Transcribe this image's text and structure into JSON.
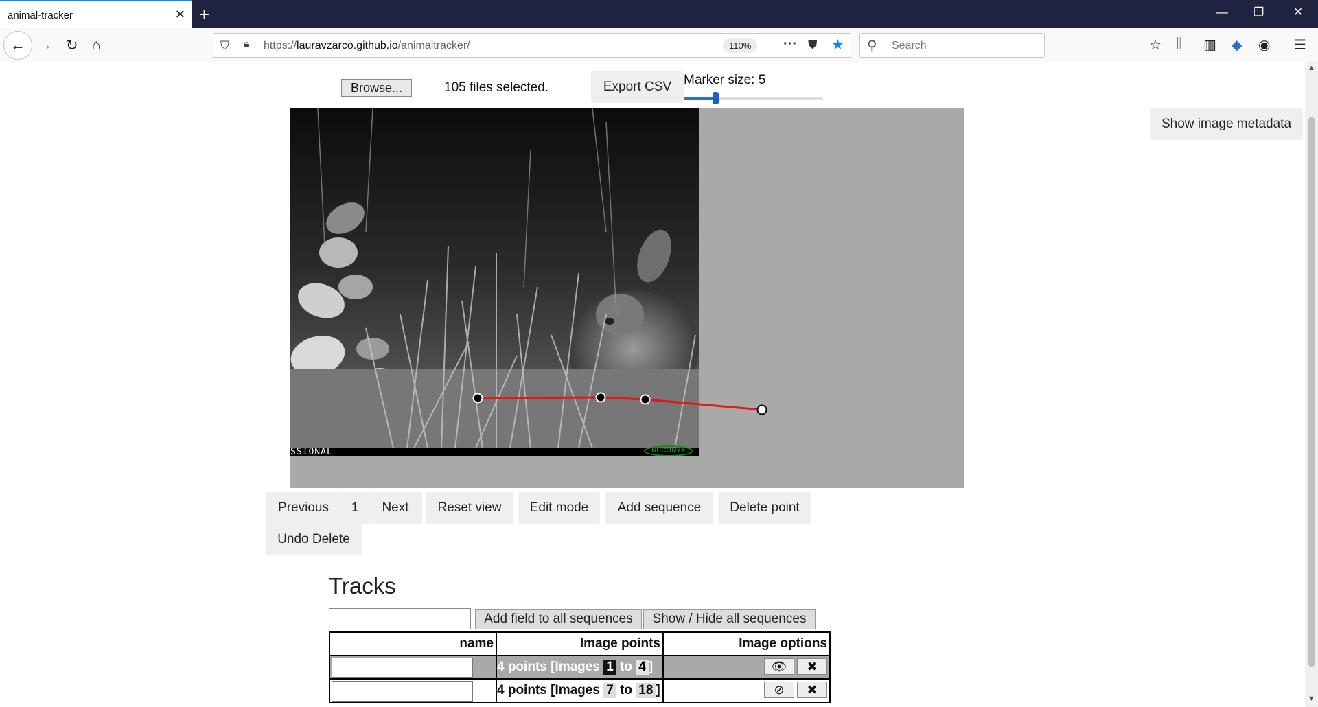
{
  "browser": {
    "tab_title": "animal-tracker",
    "url_prefix": "https://",
    "url_domain": "lauravzarco.github.io",
    "url_path": "/animaltracker/",
    "zoom": "110%",
    "search_placeholder": "Search"
  },
  "toolbar": {
    "browse_label": "Browse...",
    "files_selected": "105 files selected.",
    "export_label": "Export CSV",
    "marker_label": "Marker size: 5",
    "marker_value": 5,
    "metadata_label": "Show image metadata"
  },
  "viewer": {
    "photo_caption": "SSIONAL",
    "photo_logo": "RECONYX",
    "track_color": "#e01818"
  },
  "controls": {
    "previous": "Previous",
    "page": "1",
    "next": "Next",
    "reset": "Reset view",
    "edit": "Edit mode",
    "add_sequence": "Add sequence",
    "delete_point": "Delete point",
    "undo_delete": "Undo Delete"
  },
  "tracks": {
    "title": "Tracks",
    "add_field": "Add field to all sequences",
    "show_hide": "Show / Hide all sequences",
    "headers": [
      "name",
      "Image points",
      "Image options"
    ],
    "rows": [
      {
        "points": "4 points [Images",
        "from": "1",
        "to_word": "to",
        "to": "4",
        "close": "]",
        "visible": true
      },
      {
        "points": "4 points [Images",
        "from": "7",
        "to_word": "to",
        "to": "18",
        "close": "]",
        "visible": false
      }
    ]
  }
}
